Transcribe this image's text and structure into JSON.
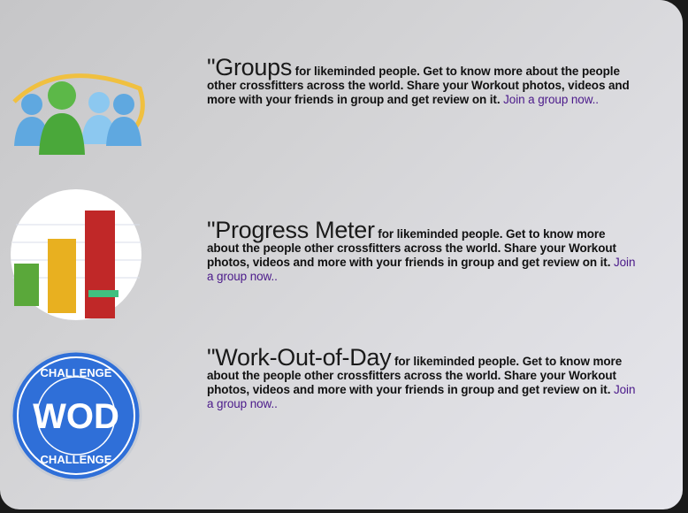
{
  "features": [
    {
      "title": "\"Groups",
      "body": " for likeminded people. Get to know more about the people other crossfitters across the world. Share your Workout photos, videos and more with your friends in group and get review on it. ",
      "link": "Join a group now.."
    },
    {
      "title": "\"Progress Meter",
      "body": " for likeminded people. Get to know more about the people other crossfitters across the world. Share your Workout photos, videos and more with your friends in group and get review on it. ",
      "link": "Join a group now.."
    },
    {
      "title": "\"Work-Out-of-Day",
      "body": " for likeminded people. Get to know more about the people other crossfitters across the world. Share your Workout photos, videos and more with your friends in group and get review on it. ",
      "link": "Join a group now.."
    }
  ],
  "wod_badge": {
    "top": "CHALLENGE",
    "center": "WOD",
    "bottom": "CHALLENGE"
  },
  "colors": {
    "link": "#4b1a8a",
    "badge": "#2f6fd8"
  }
}
